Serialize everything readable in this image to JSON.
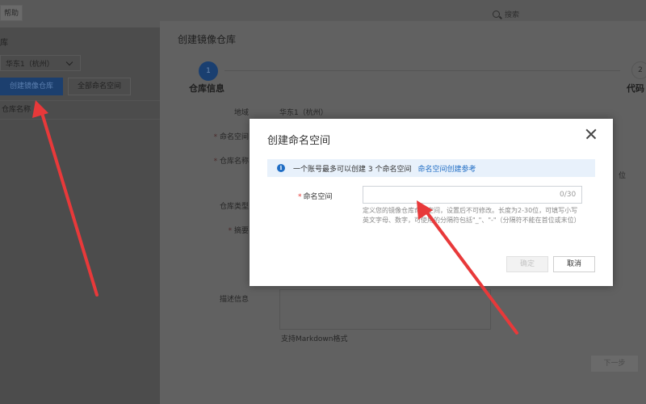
{
  "topbar": {
    "left_button_label": "帮助",
    "search_placeholder": "搜索"
  },
  "left_page": {
    "title": "库",
    "region": "华东1（杭州）",
    "create_repo_button": "创建镜像仓库",
    "namespace_tab": "全部命名空间",
    "column_repo_name": "仓库名称"
  },
  "drawer": {
    "title": "创建镜像仓库",
    "steps": [
      {
        "number": "1",
        "label": "仓库信息"
      },
      {
        "number": "2",
        "label": "代码"
      }
    ],
    "fields": {
      "region_label": "地域",
      "region_value": "华东1（杭州）",
      "namespace_label": "命名空间",
      "repo_name_label": "仓库名称",
      "repo_type_label": "仓库类型",
      "summary_label": "摘要",
      "description_label": "描述信息",
      "markdown_hint": "支持Markdown格式",
      "edge_text": "位"
    },
    "next_button": "下一步"
  },
  "modal": {
    "title": "创建命名空间",
    "info": {
      "text": "一个账号最多可以创建 3 个命名空间",
      "link": "命名空间创建参考"
    },
    "namespace_field": {
      "label": "命名空间",
      "value": "",
      "counter": "0/30",
      "help": "定义您的镜像仓库命名空间，设置后不可修改。长度为2-30位，可填写小写英文字母、数字，可使用的分隔符包括\"_\"、\"-\"（分隔符不能在首位或末位）"
    },
    "confirm_button": "确定",
    "cancel_button": "取消"
  },
  "colors": {
    "primary": "#1f6dc4",
    "info_bg": "#e8f1fb",
    "required": "#e53935",
    "annotation": "#e8393a"
  }
}
